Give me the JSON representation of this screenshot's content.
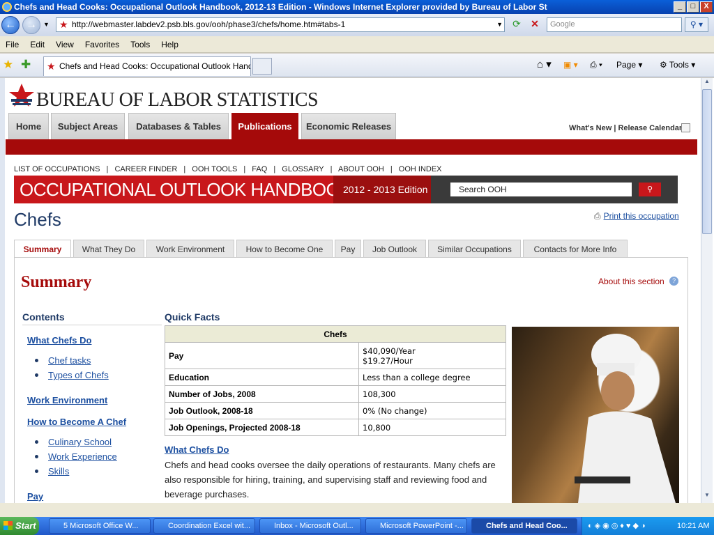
{
  "window": {
    "title": "Chefs and Head Cooks: Occupational Outlook Handbook, 2012-13 Edition - Windows Internet Explorer provided by Bureau of Labor St",
    "btn_min": "_",
    "btn_max": "□",
    "btn_close": "X"
  },
  "browser": {
    "address": "http://webmaster.labdev2.psb.bls.gov/ooh/phase3/chefs/home.htm#tabs-1",
    "search_placeholder": "Google",
    "menu": [
      "File",
      "Edit",
      "View",
      "Favorites",
      "Tools",
      "Help"
    ],
    "tab_title": "Chefs and Head Cooks: Occupational Outlook Handbo...",
    "cmd_page": "Page",
    "cmd_tools": "Tools"
  },
  "site": {
    "logo_text": "BUREAU OF LABOR STATISTICS",
    "nav": [
      "Home",
      "Subject Areas",
      "Databases & Tables",
      "Publications",
      "Economic Releases"
    ],
    "active_nav": "Publications",
    "top_links": "What's New  |  Release Calendar",
    "ooh_links": [
      "LIST OF OCCUPATIONS",
      "|",
      "CAREER FINDER",
      "|",
      "OOH TOOLS",
      "|",
      "FAQ",
      "|",
      "GLOSSARY",
      "|",
      "ABOUT OOH",
      "|",
      "OOH INDEX"
    ],
    "ooh_title": "OCCUPATIONAL OUTLOOK HANDBOOK",
    "ooh_edition": "2012 - 2013 Edition",
    "ooh_search": "Search OOH"
  },
  "page": {
    "title": "Chefs",
    "print_link": "Print this occupation",
    "tabs": [
      "Summary",
      "What They Do",
      "Work Environment",
      "How to Become One",
      "Pay",
      "Job Outlook",
      "Similar Occupations",
      "Contacts for More Info"
    ],
    "section_title": "Summary",
    "about_section": "About this section",
    "contents_heading": "Contents",
    "toc": {
      "what_chefs_do": "What Chefs Do",
      "chef_tasks": "Chef tasks",
      "types_of_chefs": "Types of Chefs",
      "work_environment": "Work Environment",
      "how_to_become": "How to Become A Chef",
      "culinary_school": "Culinary School",
      "work_experience": "Work Experience",
      "skills": "Skills",
      "pay": "Pay"
    },
    "quick_facts_heading": "Quick Facts",
    "quick_facts": {
      "header": "Chefs",
      "rows": [
        {
          "label": "Pay",
          "value": "$40,090/Year",
          "value2": "$19.27/Hour"
        },
        {
          "label": "Education",
          "value": "Less than a college degree"
        },
        {
          "label": "Number of Jobs, 2008",
          "value": "108,300"
        },
        {
          "label": "Job Outlook, 2008-18",
          "value": "0% (No change)"
        },
        {
          "label": "Job Openings, Projected 2008-18",
          "value": "10,800"
        }
      ]
    },
    "what_chefs_do_heading": "What Chefs Do",
    "what_chefs_do_text": "Chefs and head cooks oversee the daily operations of restaurants. Many chefs are also responsible for hiring, training, and supervising staff and reviewing food and beverage purchases."
  },
  "taskbar": {
    "start": "Start",
    "tasks": [
      "5 Microsoft Office W...",
      "Coordination Excel wit...",
      "Inbox - Microsoft Outl...",
      "Microsoft PowerPoint -...",
      "Chefs and Head Coo..."
    ],
    "clock": "10:21 AM"
  }
}
